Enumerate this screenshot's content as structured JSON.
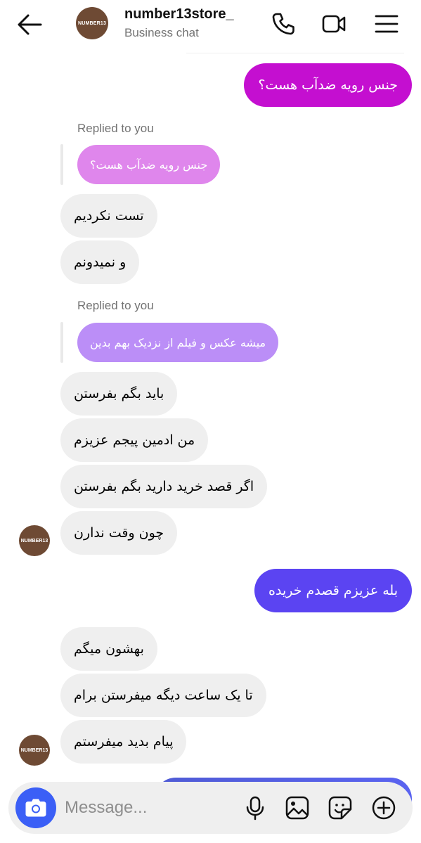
{
  "header": {
    "back_icon": "arrow-left-icon",
    "avatar_text": "NUMBER13",
    "name": "number13store_",
    "subtitle": "Business chat",
    "actions": [
      "phone-icon",
      "video-camera-icon",
      "menu-icon"
    ]
  },
  "messages": {
    "out1": "جنس رویه ضدآب هست؟",
    "reply1_label": "Replied to you",
    "reply1_quote": "جنس رویه ضدآب هست؟",
    "in1": "تست نکردیم",
    "in2": "و نمیدونم",
    "reply2_label": "Replied to you",
    "reply2_quote": "میشه عکس و فیلم از نزدیک بهم بدین",
    "in3": "باید بگم بفرستن",
    "in4": "من ادمین پیجم عزیزم",
    "in5": "اگر قصد خرید دارید بگم بفرستن",
    "in6": "چون وقت ندارن",
    "out2": "بله عزیزم قصدم خریده",
    "in7": "بهشون میگم",
    "in8": "تا یک ساعت دیگه میفرستن برام",
    "in9": "پیام بدید میفرستم",
    "avatar_text": "NUMBER13"
  },
  "composer": {
    "placeholder": "Message...",
    "icons": [
      "camera-icon",
      "microphone-icon",
      "gallery-icon",
      "sticker-icon",
      "plus-icon"
    ]
  },
  "colors": {
    "out1_bubble": "#c40fd0",
    "out2_bubble": "#5b44f2",
    "quote1": "#df86ec",
    "quote2": "#bb8ef7",
    "incoming_bubble": "#efefef",
    "camera_button": "#3b5ff6",
    "avatar": "#6e4a34"
  }
}
